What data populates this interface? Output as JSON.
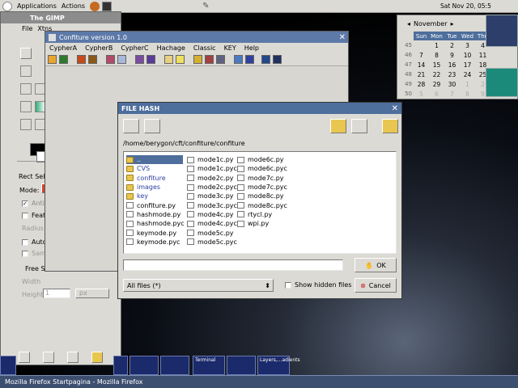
{
  "top_panel": {
    "menus": [
      "Applications",
      "Actions"
    ],
    "clock": "Sat Nov 20, 05:5"
  },
  "gimp": {
    "title": "The GIMP",
    "menus": [
      "File",
      "Xtns"
    ],
    "tool_options_title": "Rect Selec",
    "mode_label": "Mode:",
    "antialias": "Antia",
    "feather": "Feat",
    "radius": "Radius",
    "auto": "Auto",
    "sample": "Sam",
    "free_select": "Free Se",
    "width": "Width",
    "height": "Height",
    "height_value": "1",
    "unit": "px"
  },
  "confiture": {
    "title": "Confiture version 1.0",
    "menus": [
      "CypherA",
      "CypherB",
      "CypherC",
      "Hachage",
      "Classic",
      "KEY",
      "Help"
    ]
  },
  "calendar": {
    "month": "November",
    "days": [
      "Sun",
      "Mon",
      "Tue",
      "Wed",
      "Thu"
    ],
    "weeks": [
      {
        "n": "45",
        "d": [
          "",
          "1",
          "2",
          "3",
          "4"
        ]
      },
      {
        "n": "46",
        "d": [
          "7",
          "8",
          "9",
          "10",
          "11"
        ]
      },
      {
        "n": "47",
        "d": [
          "14",
          "15",
          "16",
          "17",
          "18"
        ]
      },
      {
        "n": "48",
        "d": [
          "21",
          "22",
          "23",
          "24",
          "25"
        ]
      },
      {
        "n": "49",
        "d": [
          "28",
          "29",
          "30",
          "1",
          "2"
        ]
      },
      {
        "n": "50",
        "d": [
          "5",
          "6",
          "7",
          "8",
          "9"
        ]
      }
    ]
  },
  "file_hash": {
    "title": "FILE HASH",
    "path": "/home/berygon/cft/confiture/confiture",
    "col1": [
      {
        "name": "..",
        "type": "folder",
        "sel": true
      },
      {
        "name": "CVS",
        "type": "folder"
      },
      {
        "name": "confiture",
        "type": "folder"
      },
      {
        "name": "images",
        "type": "folder"
      },
      {
        "name": "key",
        "type": "folder"
      },
      {
        "name": "confiture.py",
        "type": "file"
      },
      {
        "name": "hashmode.py",
        "type": "file"
      },
      {
        "name": "hashmode.pyc",
        "type": "file"
      },
      {
        "name": "keymode.py",
        "type": "file"
      },
      {
        "name": "keymode.pyc",
        "type": "file"
      }
    ],
    "col2": [
      "mode1c.py",
      "mode1c.pyc",
      "mode2c.py",
      "mode2c.pyc",
      "mode3c.py",
      "mode3c.pyc",
      "mode4c.py",
      "mode4c.pyc",
      "mode5c.py",
      "mode5c.pyc"
    ],
    "col3": [
      "mode6c.py",
      "mode6c.pyc",
      "mode7c.py",
      "mode7c.pyc",
      "mode8c.py",
      "mode8c.pyc",
      "rtycl.py",
      "wpi.py"
    ],
    "filter": "All files (*)",
    "show_hidden": "Show hidden files",
    "ok": "OK",
    "cancel": "Cancel",
    "filename_value": ""
  },
  "taskbar": {
    "window": "Mozilla Firefox Startpagina - Mozilla Firefox",
    "thumb_terminal": "Terminal",
    "thumb_layers": "Layers,...adients"
  }
}
